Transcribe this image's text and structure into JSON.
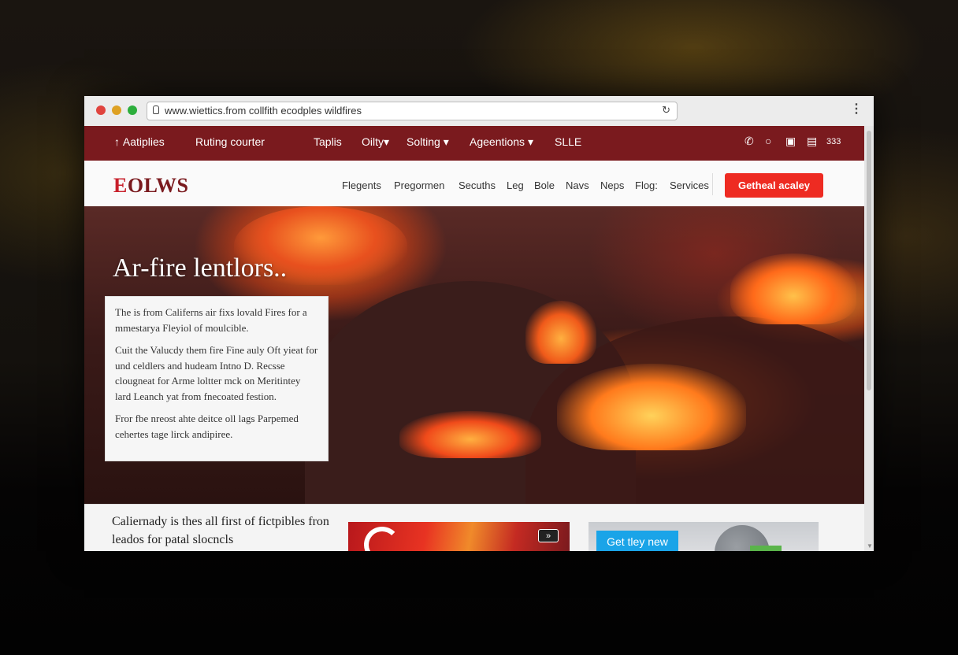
{
  "browser": {
    "url": "www.wiettics.from collfith ecodples wildfires",
    "reload_icon": "refresh-icon",
    "menu_icon": "kebab-menu-icon"
  },
  "topnav": {
    "items": [
      "Aatiplies",
      "Ruting courter",
      "Taplis",
      "Oilty",
      "Solting",
      "Ageentions",
      "SLLE"
    ],
    "dropdowns": [
      "Oilty",
      "Solting",
      "Ageentions"
    ],
    "right_text": "333",
    "bg_color": "#7a1a1e"
  },
  "header": {
    "logo_first": "E",
    "logo_rest": "OLWS",
    "nav": [
      "Flegents",
      "Pregormen",
      "Secuths",
      "Leg",
      "Bole",
      "Navs",
      "Neps",
      "Flog:",
      "Services"
    ],
    "cta": "Getheal acaley",
    "cta_color": "#ee2b22"
  },
  "hero": {
    "headline": "Ar-fire lentlors..",
    "paragraphs": [
      "The is from Califerns air fixs lovald Fires for a mmestarya Fleyiol of moulcible.",
      "Cuit the Valucdy them fire Fine auly Oft yieat for und celdlers and hudeam Intno D. Recsse clougneat for Arme loltter mck on Meritintey lard Leanch yat from fnecoated festion.",
      "Fror fbe nreost ahte deitce oll lags Parpemed cehertes tage lirck andipiree."
    ]
  },
  "bottom": {
    "title": "Caliernady is thes all first of fictpibles fron leados for patal slocncls",
    "card1_icon": "fast-forward-icon",
    "card2_button": "Get tley new",
    "card2_color": "#1aa4e8"
  }
}
